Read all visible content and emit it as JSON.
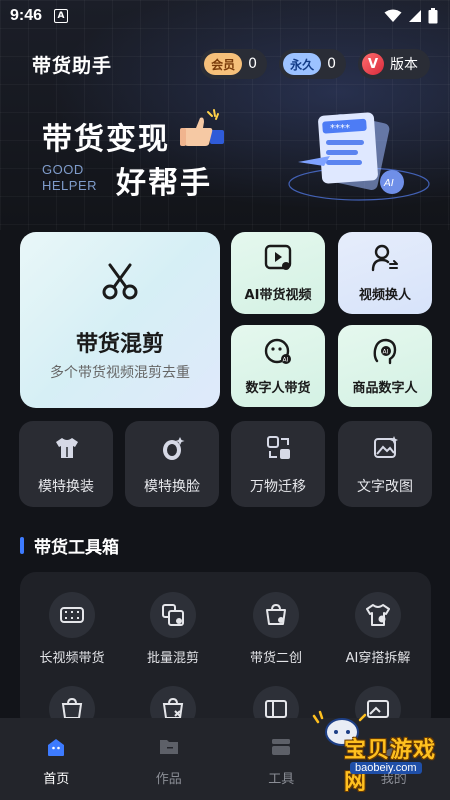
{
  "status_bar": {
    "time": "9:46",
    "notif_letter": "A"
  },
  "header": {
    "title": "带货助手",
    "member_label": "会员",
    "member_count": "0",
    "forever_label": "永久",
    "forever_count": "0",
    "version_badge": "V",
    "version_label": "版本"
  },
  "banner": {
    "main_text": "带货变现",
    "sub_text": "好帮手",
    "en_line1": "GOOD",
    "en_line2": "HELPER",
    "art_stars": "****",
    "art_ai": "AI"
  },
  "feature_main": {
    "title": "带货混剪",
    "subtitle": "多个带货视频混剪去重",
    "icon": "scissors-icon"
  },
  "feature_cards": [
    {
      "label": "AI带货视频",
      "icon": "video-play-icon"
    },
    {
      "label": "视频换人",
      "icon": "person-swap-icon"
    },
    {
      "label": "数字人带货",
      "icon": "ai-face-icon"
    },
    {
      "label": "商品数字人",
      "icon": "ai-head-icon"
    }
  ],
  "quick_tools": [
    {
      "label": "模特换装",
      "icon": "shirt-icon"
    },
    {
      "label": "模特换脸",
      "icon": "face-swap-icon"
    },
    {
      "label": "万物迁移",
      "icon": "transfer-icon"
    },
    {
      "label": "文字改图",
      "icon": "image-edit-icon"
    }
  ],
  "toolbox": {
    "title": "带货工具箱",
    "items": [
      {
        "label": "长视频带货",
        "icon": "film-icon"
      },
      {
        "label": "批量混剪",
        "icon": "batch-cut-icon"
      },
      {
        "label": "带货二创",
        "icon": "cart-create-icon"
      },
      {
        "label": "AI穿搭拆解",
        "icon": "shirt-ai-icon"
      }
    ]
  },
  "bottom_nav": [
    {
      "label": "首页",
      "active": true,
      "icon": "home-icon"
    },
    {
      "label": "作品",
      "active": false,
      "icon": "folder-icon"
    },
    {
      "label": "工具",
      "active": false,
      "icon": "tools-icon"
    },
    {
      "label": "我的",
      "active": false,
      "icon": "profile-icon"
    }
  ],
  "watermark": {
    "text": "宝贝游戏网",
    "url": "baobeiy.com"
  },
  "colors": {
    "accent": "#3d7bff",
    "background": "#121419",
    "card_dark": "#2a2c33"
  }
}
